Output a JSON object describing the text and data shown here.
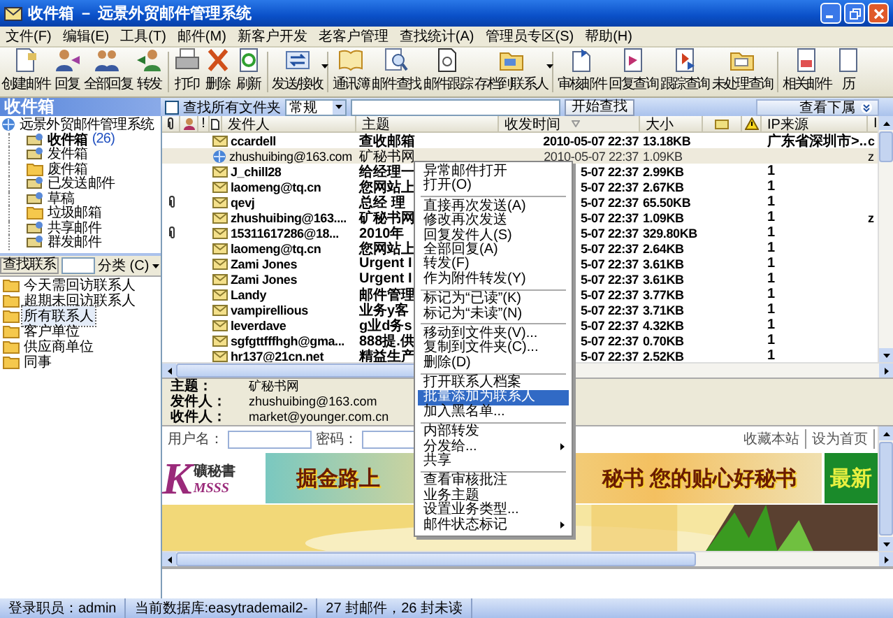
{
  "window": {
    "title": "收件箱 － 远景外贸邮件管理系统"
  },
  "menu": [
    "文件(F)",
    "编辑(E)",
    "工具(T)",
    "邮件(M)",
    "新客户开发",
    "老客户管理",
    "查找统计(A)",
    "管理员专区(S)",
    "帮助(H)"
  ],
  "toolbar": [
    [
      {
        "label": "创建邮件",
        "dropdown": false
      },
      {
        "label": "回复",
        "dropdown": false
      },
      {
        "label": "全部回复",
        "dropdown": false
      },
      {
        "label": "转发",
        "dropdown": false
      }
    ],
    [
      {
        "label": "打印",
        "dropdown": false
      },
      {
        "label": "删除",
        "dropdown": false
      },
      {
        "label": "刷新",
        "dropdown": false
      }
    ],
    [
      {
        "label": "发送/接收",
        "dropdown": true
      }
    ],
    [
      {
        "label": "通讯簿",
        "dropdown": false
      },
      {
        "label": "邮件查找",
        "dropdown": false
      },
      {
        "label": "邮件跟踪",
        "dropdown": false
      },
      {
        "label": "存档到联系人",
        "dropdown": true
      }
    ],
    [
      {
        "label": "审核邮件",
        "dropdown": false
      },
      {
        "label": "回复查询",
        "dropdown": false
      },
      {
        "label": "跟踪查询",
        "dropdown": false
      },
      {
        "label": "未处理查询",
        "dropdown": false
      }
    ],
    [
      {
        "label": "相关邮件",
        "dropdown": false
      },
      {
        "label": "历",
        "dropdown": false
      }
    ]
  ],
  "panel_title": "收件箱",
  "search_bar": {
    "all_folders": {
      "label": "查找所有文件夹",
      "checked": false
    },
    "scope": "常规",
    "button": "开始查找",
    "subordinates_button": "查看下属"
  },
  "folder_tree": {
    "label": "远景外贸邮件管理系统",
    "children": [
      {
        "label": "收件箱",
        "count": "(26)",
        "selected": true
      },
      {
        "label": "发件箱",
        "selected": false
      },
      {
        "label": "废件箱",
        "selected": false
      },
      {
        "label": "已发送邮件",
        "selected": false
      },
      {
        "label": "草稿",
        "selected": false
      },
      {
        "label": "垃圾邮箱",
        "selected": false
      },
      {
        "label": "共享邮件",
        "selected": false
      },
      {
        "label": "群发邮件",
        "selected": false
      }
    ]
  },
  "contacts": {
    "search_button": "查找联系",
    "category": "分类 (C)",
    "groups": [
      {
        "label": "今天需回访联系人",
        "selected": false
      },
      {
        "label": "超期未回访联系人",
        "selected": false
      },
      {
        "label": "所有联系人",
        "selected": true
      },
      {
        "label": "客户单位",
        "selected": false
      },
      {
        "label": "供应商单位",
        "selected": false
      },
      {
        "label": "同事",
        "selected": false
      }
    ]
  },
  "mail_list": {
    "columns": [
      {
        "label": "!",
        "sorted": false
      },
      {
        "label": "发件人",
        "sorted": false
      },
      {
        "label": "主题",
        "sorted": false
      },
      {
        "label": "收发时间",
        "sorted": true
      },
      {
        "label": "大小",
        "sorted": false
      },
      {
        "label": "IP来源",
        "sorted": false
      },
      {
        "label": "I",
        "sorted": false
      }
    ],
    "rows": [
      {
        "attachment": false,
        "unread": true,
        "selected": false,
        "sender": "ccardell",
        "subject": "查收邮箱",
        "time": "2010-05-07 22:37",
        "size": "13.18KB",
        "ip": "广东省深圳市>...",
        "column_12": "c"
      },
      {
        "attachment": false,
        "unread": false,
        "selected": true,
        "sender": "zhushuibing@163.com",
        "subject": "矿秘书网",
        "time": "2010-05-07 22:37",
        "size": "1.09KB",
        "column_12": "z"
      },
      {
        "attachment": false,
        "unread": true,
        "selected": false,
        "sender": "J_chill28",
        "subject": "给经理一",
        "time": "5-07 22:37",
        "size": "2.99KB",
        "ip": "1"
      },
      {
        "attachment": false,
        "unread": true,
        "selected": false,
        "sender": "laomeng@tq.cn",
        "subject": "您网站上",
        "time": "5-07 22:37",
        "size": "2.67KB",
        "ip": "1"
      },
      {
        "attachment": true,
        "unread": true,
        "selected": false,
        "sender": "qevj",
        "subject": "总经 理",
        "time": "5-07 22:37",
        "size": "65.50KB",
        "ip": "1"
      },
      {
        "attachment": false,
        "unread": true,
        "selected": false,
        "sender": "zhushuibing@163....",
        "subject": "矿秘书网",
        "time": "5-07 22:37",
        "size": "1.09KB",
        "ip": "1",
        "column_12": "z"
      },
      {
        "attachment": true,
        "unread": true,
        "selected": false,
        "sender": "15311617286@18...",
        "subject": "2010年",
        "time": "5-07 22:37",
        "size": "329.80KB",
        "ip": "1"
      },
      {
        "attachment": false,
        "unread": true,
        "selected": false,
        "sender": "laomeng@tq.cn",
        "subject": "您网站上",
        "time": "5-07 22:37",
        "size": "2.64KB",
        "ip": "1"
      },
      {
        "attachment": false,
        "unread": true,
        "selected": false,
        "sender": "Zami Jones",
        "subject": "Urgent I",
        "time": "5-07 22:37",
        "size": "3.61KB",
        "ip": "1"
      },
      {
        "attachment": false,
        "unread": true,
        "selected": false,
        "sender": "Zami Jones",
        "subject": "Urgent I",
        "time": "5-07 22:37",
        "size": "3.61KB",
        "ip": "1"
      },
      {
        "attachment": false,
        "unread": true,
        "selected": false,
        "sender": "Landy",
        "subject": "邮件管理",
        "time": "5-07 22:37",
        "size": "3.77KB",
        "ip": "1"
      },
      {
        "attachment": false,
        "unread": true,
        "selected": false,
        "sender": "vampirellious",
        "subject": "业务y客",
        "time": "5-07 22:37",
        "size": "3.71KB",
        "ip": "1"
      },
      {
        "attachment": false,
        "unread": true,
        "selected": false,
        "sender": "leverdave",
        "subject": "g业d务s",
        "time": "5-07 22:37",
        "size": "4.32KB",
        "ip": "1"
      },
      {
        "attachment": false,
        "unread": true,
        "selected": false,
        "sender": "sgfgttfffhgh@gma...",
        "subject": "888提.供",
        "time": "5-07 22:37",
        "size": "0.70KB",
        "ip": "1"
      },
      {
        "attachment": false,
        "unread": true,
        "selected": false,
        "sender": "hr137@21cn.net",
        "subject": "精益生产",
        "time": "5-07 22:37",
        "size": "2.52KB",
        "ip": "1"
      }
    ]
  },
  "context_menu": {
    "groups": [
      [
        {
          "label": "异常邮件打开",
          "selected": false,
          "submenu": false
        },
        {
          "label": "打开(O)",
          "selected": false,
          "submenu": false
        }
      ],
      [
        {
          "label": "直接再次发送(A)",
          "selected": false,
          "submenu": false
        },
        {
          "label": "修改再次发送",
          "selected": false,
          "submenu": false
        },
        {
          "label": "回复发件人(S)",
          "selected": false,
          "submenu": false
        },
        {
          "label": "全部回复(A)",
          "selected": false,
          "submenu": false
        },
        {
          "label": "转发(F)",
          "selected": false,
          "submenu": false
        },
        {
          "label": "作为附件转发(Y)",
          "selected": false,
          "submenu": false
        }
      ],
      [
        {
          "label": "标记为“已读”(K)",
          "selected": false,
          "submenu": false
        },
        {
          "label": "标记为“未读”(N)",
          "selected": false,
          "submenu": false
        }
      ],
      [
        {
          "label": "移动到文件夹(V)...",
          "selected": false,
          "submenu": false
        },
        {
          "label": "复制到文件夹(C)...",
          "selected": false,
          "submenu": false
        },
        {
          "label": "删除(D)",
          "selected": false,
          "submenu": false
        }
      ],
      [
        {
          "label": "打开联系人档案",
          "selected": false,
          "submenu": false
        },
        {
          "label": "批量添加为联系人",
          "selected": true,
          "submenu": false
        },
        {
          "label": "加入黑名单...",
          "selected": false,
          "submenu": false
        }
      ],
      [
        {
          "label": "内部转发",
          "selected": false,
          "submenu": false
        },
        {
          "label": "分发给...",
          "selected": false,
          "submenu": true
        },
        {
          "label": "共享",
          "selected": false,
          "submenu": false
        }
      ],
      [
        {
          "label": "查看审核批注",
          "selected": false,
          "submenu": false
        },
        {
          "label": "业务主题",
          "selected": false,
          "submenu": false
        },
        {
          "label": "设置业务类型...",
          "selected": false,
          "submenu": false
        },
        {
          "label": "邮件状态标记",
          "selected": false,
          "submenu": true
        }
      ]
    ]
  },
  "preview": {
    "fields": [
      {
        "label": "主题：",
        "value": "矿秘书网"
      },
      {
        "label": "发件人：",
        "value": "zhushuibing@163.com"
      },
      {
        "label": "收件人：",
        "value": "market@younger.com.cn"
      }
    ],
    "page": {
      "username_label": "用户名：",
      "password_label": "密码：",
      "links": [
        "收藏本站",
        "设为首页"
      ],
      "logo": {
        "initial": "K",
        "name": "礦秘書",
        "latin": "MSSS"
      },
      "banner": [
        "掘金路上",
        "秘书 您的贴心好秘书"
      ],
      "badge": "最新"
    }
  },
  "status_bar": [
    "登录职员：admin",
    "当前数据库:easytrademail2-",
    "27 封邮件，26 封未读"
  ]
}
